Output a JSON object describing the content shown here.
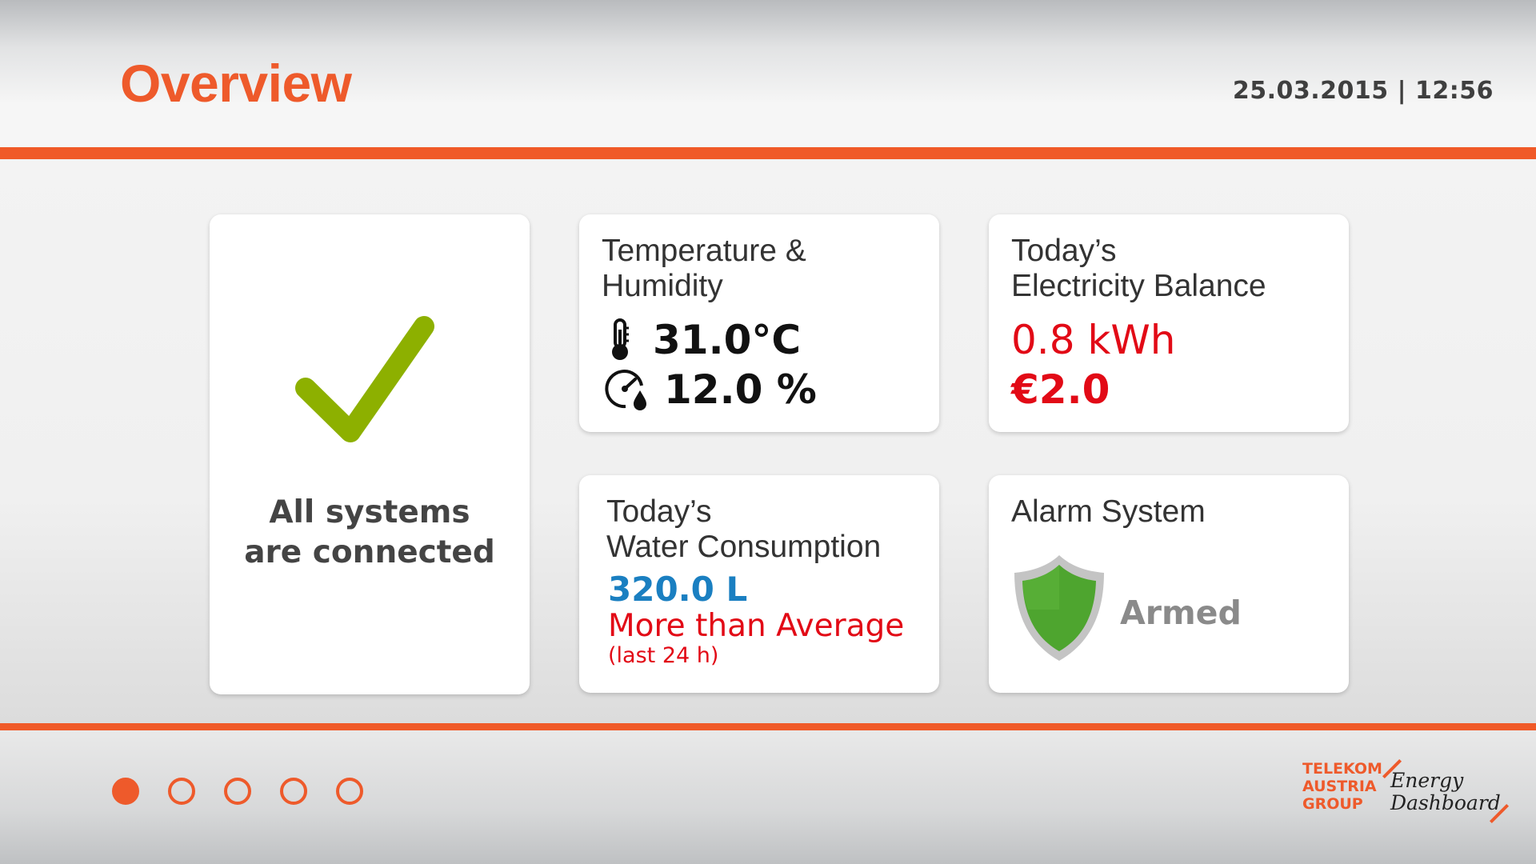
{
  "header": {
    "title": "Overview",
    "datetime": "25.03.2015 | 12:56"
  },
  "status_card": {
    "icon": "check-icon",
    "line1": "All systems",
    "line2": "are connected"
  },
  "temperature_card": {
    "title_line1": "Temperature &",
    "title_line2": "Humidity",
    "temperature": "31.0°C",
    "humidity": "12.0 %",
    "temperature_icon": "thermometer-icon",
    "humidity_icon": "humidity-gauge-icon"
  },
  "electricity_card": {
    "title_line1": "Today’s",
    "title_line2": "Electricity Balance",
    "energy": "0.8 kWh",
    "cost": "€2.0"
  },
  "water_card": {
    "title_line1": "Today’s",
    "title_line2": "Water Consumption",
    "value": "320.0 L",
    "comparison": "More than Average",
    "period": "(last 24 h)"
  },
  "alarm_card": {
    "title": "Alarm System",
    "status": "Armed",
    "icon": "shield-icon"
  },
  "pagination": {
    "pages": 5,
    "active": 1
  },
  "footer": {
    "brand_line1": "TELEKOM",
    "brand_line2": "AUSTRIA",
    "brand_line3": "GROUP",
    "product_line1": "Energy",
    "product_line2": "Dashboard"
  },
  "colors": {
    "accent": "#f05a28",
    "ok_green": "#8db000",
    "alert_red": "#e20a16",
    "water_blue": "#1a7fc1",
    "shield_green": "#4ea52f"
  }
}
